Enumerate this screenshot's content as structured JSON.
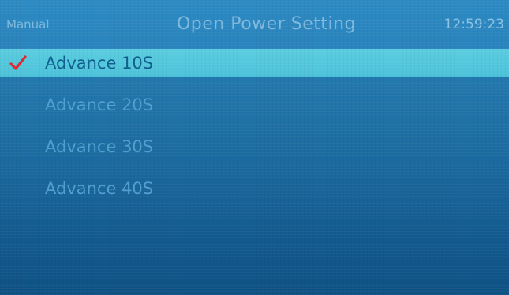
{
  "header": {
    "mode": "Manual",
    "title": "Open Power Setting",
    "time": "12:59:23"
  },
  "menu": {
    "items": [
      {
        "label": "Advance 10S",
        "selected": true
      },
      {
        "label": "Advance 20S",
        "selected": false
      },
      {
        "label": "Advance 30S",
        "selected": false
      },
      {
        "label": "Advance 40S",
        "selected": false
      }
    ]
  },
  "colors": {
    "selection": "#4cc2d9",
    "check": "#e0262e"
  },
  "icons": {
    "selected_marker": "checkmark-icon"
  }
}
